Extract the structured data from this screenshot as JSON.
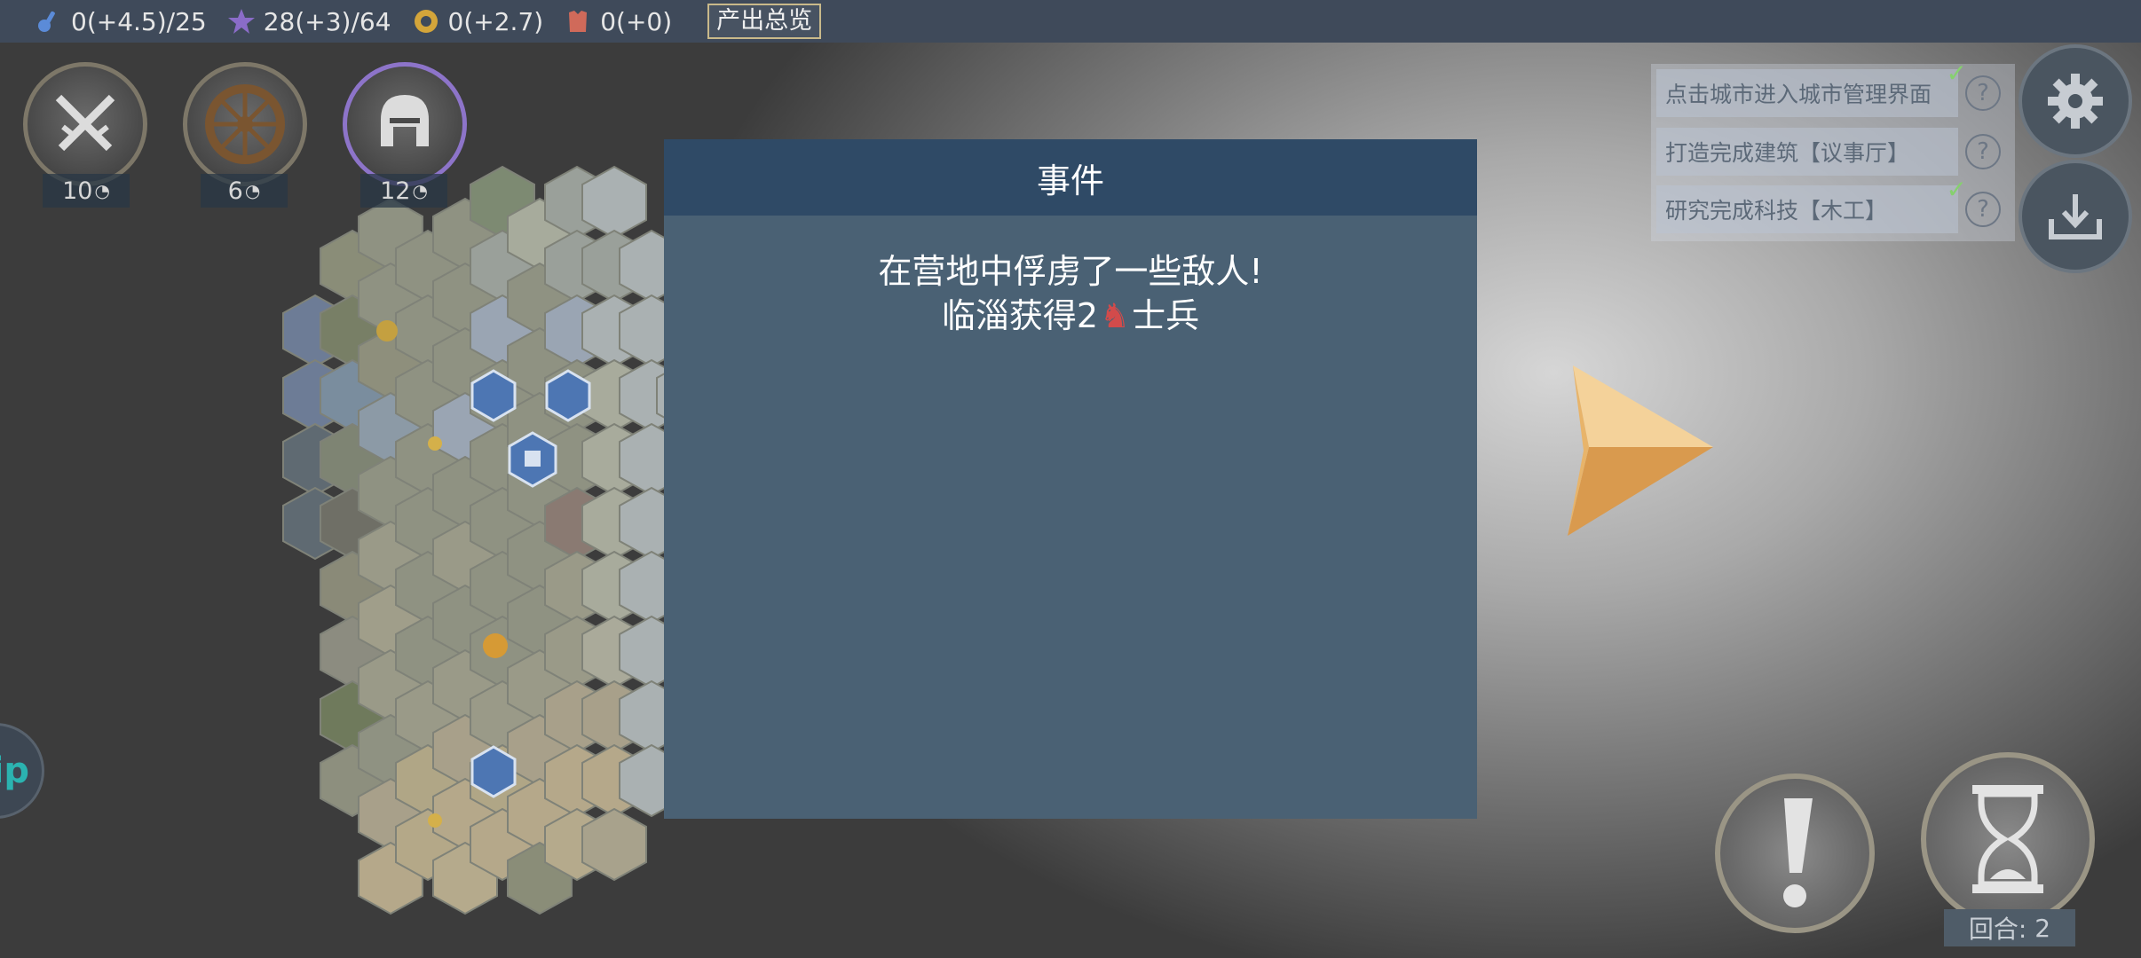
{
  "resources": [
    {
      "icon": "science-icon",
      "value": "0(+4.5)/25",
      "color": "#5b8bd8"
    },
    {
      "icon": "star-icon",
      "value": "28(+3)/64",
      "color": "#8a6cc8"
    },
    {
      "icon": "gold-coin-icon",
      "value": "0(+2.7)",
      "color": "#d4a53a"
    },
    {
      "icon": "armor-icon",
      "value": "0(+0)",
      "color": "#d06a5a"
    }
  ],
  "overview_button": "产出总览",
  "unit_buttons": [
    {
      "icon": "crossed-swords-icon",
      "count": "10"
    },
    {
      "icon": "wheel-icon",
      "count": "6"
    },
    {
      "icon": "helmet-icon",
      "count": "12"
    }
  ],
  "dialog": {
    "title": "事件",
    "line1": "在营地中俘虏了一些敌人!",
    "line2_prefix": "临淄获得2",
    "line2_suffix": "士兵"
  },
  "quests": [
    {
      "label": "点击城市进入城市管理界面",
      "done": true
    },
    {
      "label": "打造完成建筑【议事厅】",
      "done": false
    },
    {
      "label": "研究完成科技【木工】",
      "done": true
    }
  ],
  "left_tab_text": "ip",
  "turn": {
    "label": "回合:",
    "value": "2"
  },
  "colors": {
    "dialog_bg": "#4a6174",
    "dialog_header": "#2f4a66",
    "arrow": "#e8b46a",
    "check": "#86d06e"
  }
}
